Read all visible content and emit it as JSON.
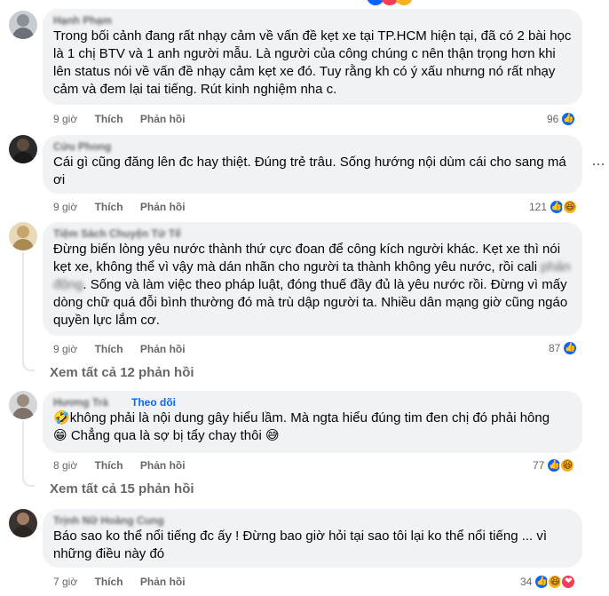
{
  "comments": [
    {
      "author": "Hạnh Phạm",
      "text": "Trong bối cảnh đang rất nhạy cảm về vấn đề kẹt xe tại TP.HCM hiện tại, đã có 2 bài học là 1 chị BTV và 1 anh người mẫu. Là người của công chúng c nên thận trọng hơn khi lên status nói về vấn đề nhạy cảm kẹt xe đó. Tuy rằng kh có ý xấu nhưng nó rất nhạy cảm và đem lại tai tiếng. Rút kinh nghiệm nha c.",
      "time": "9 giờ",
      "like_label": "Thích",
      "reply_label": "Phản hồi",
      "reaction_count": "96"
    },
    {
      "author": "Cửu Phong",
      "text": "Cái gì cũng đăng lên đc hay thiệt. Đúng trẻ trâu. Sống hướng nội dùm cái cho sang má ơi",
      "time": "9 giờ",
      "like_label": "Thích",
      "reply_label": "Phản hồi",
      "reaction_count": "121"
    },
    {
      "author": "Tiệm Sách Chuyện Tử Tế",
      "text_part1": "Đừng biến lòng yêu nước thành thứ cực đoan để công kích người khác. Kẹt xe thì nói kẹt xe, không thể vì vậy mà dán nhãn cho người ta thành không yêu nước, rồi cali ",
      "text_blur1": "phản động",
      "text_part2": ". Sống và làm việc theo pháp luật, đóng thuế đầy đủ là yêu nước rồi. Đừng vì mấy dòng chữ quá đỗi bình thường đó mà trù dập người ta. Nhiều dân mạng giờ cũng ngáo quyền lực lắm cơ.",
      "time": "9 giờ",
      "like_label": "Thích",
      "reply_label": "Phản hồi",
      "reaction_count": "87",
      "view_replies": "Xem tất cả 12 phản hồi"
    },
    {
      "author": "Hương Trà",
      "follow_label": "Theo dõi",
      "line1": "không phải là nội dung gây hiểu lầm. Mà ngta hiểu đúng tim đen chị đó phải hông",
      "line2": "Chẳng qua là sợ bị tẩy chay thôi",
      "time": "8 giờ",
      "like_label": "Thích",
      "reply_label": "Phản hồi",
      "reaction_count": "77",
      "view_replies": "Xem tất cả 15 phản hồi"
    },
    {
      "author": "Trịnh Nữ Hoàng Cung",
      "text": "Báo sao ko thể nổi tiếng đc ấy ! Đừng bao giờ hỏi tại sao tôi lại ko thể nổi tiếng ... vì những điều này đó",
      "time": "7 giờ",
      "like_label": "Thích",
      "reply_label": "Phản hồi",
      "reaction_count": "34"
    }
  ],
  "icons": {
    "like": "like-reaction-icon",
    "haha": "haha-reaction-icon",
    "love": "love-reaction-icon",
    "laugh_emoji": "rolling-laughing-emoji",
    "smile_emoji": "grinning-emoji",
    "sweat_emoji": "sweat-smile-emoji",
    "more": "more-options-icon"
  },
  "colors": {
    "bubble": "#f0f2f5",
    "meta": "#65676b",
    "like": "#0866ff",
    "haha": "#f7b125",
    "love": "#f33e58",
    "follow": "#0866ff"
  }
}
